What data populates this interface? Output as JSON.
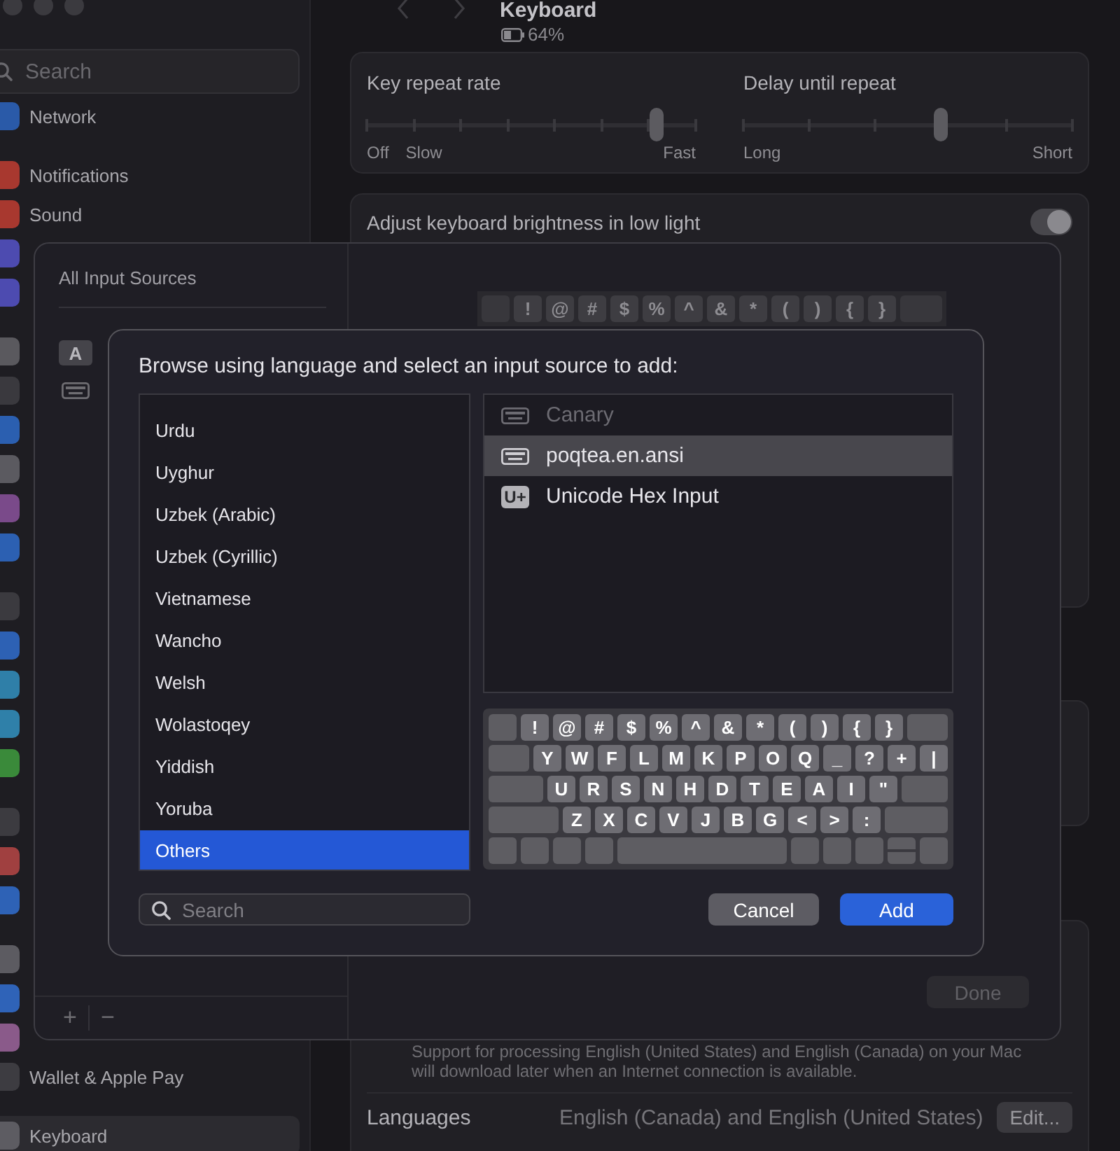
{
  "sidebar": {
    "search": {
      "placeholder": "Search"
    },
    "groups": [
      {
        "items": [
          {
            "label": "Network",
            "color": "#2a5aa8",
            "selected": false
          }
        ]
      },
      {
        "items": [
          {
            "label": "Notifications",
            "color": "#a8382f",
            "selected": false
          },
          {
            "label": "Sound",
            "color": "#a8382f",
            "selected": false
          },
          {
            "color": "#4d4bb0",
            "selected": false
          },
          {
            "color": "#4d4bb0",
            "selected": false
          }
        ]
      },
      {
        "items": [
          {
            "color": "#5a595e",
            "selected": false
          },
          {
            "color": "#3a393e",
            "selected": false
          },
          {
            "color": "#2b5fb0",
            "selected": false
          },
          {
            "color": "#5b5a60",
            "selected": false
          },
          {
            "color": "#7a4a8a",
            "selected": false
          },
          {
            "color": "#2c60b2",
            "selected": false
          }
        ]
      },
      {
        "items": [
          {
            "color": "#3b3a3f",
            "selected": false
          },
          {
            "color": "#2d61b4",
            "selected": false
          },
          {
            "color": "#2f7fa8",
            "selected": false
          },
          {
            "color": "#2f80a9",
            "selected": false
          },
          {
            "color": "#3a8a3a",
            "selected": false
          }
        ]
      },
      {
        "items": [
          {
            "color": "#3c3b40",
            "selected": false
          },
          {
            "color": "#a04040",
            "selected": false
          },
          {
            "color": "#2e62b6",
            "selected": false
          }
        ]
      },
      {
        "items": [
          {
            "color": "#5c5b61",
            "selected": false
          },
          {
            "color": "#2f63b8",
            "selected": false
          },
          {
            "color": "#8a5a8a",
            "selected": false
          },
          {
            "label": "Wallet & Apple Pay",
            "color": "#3d3c41",
            "selected": false
          }
        ]
      },
      {
        "items": [
          {
            "label": "Keyboard",
            "color": "#5d5c62",
            "selected": true
          }
        ]
      }
    ]
  },
  "settings": {
    "title": "Keyboard",
    "battery": "64%",
    "sliders": [
      {
        "kind": "rate",
        "label": "Key repeat rate",
        "level": 0.88,
        "scale": [
          "Off",
          "Slow",
          "Fast"
        ]
      },
      {
        "kind": "delay",
        "label": "Delay until repeat",
        "level": 0.6,
        "scale": [
          "Long",
          "Short"
        ]
      }
    ],
    "brightness": {
      "label": "Adjust keyboard brightness in low light",
      "on": true
    },
    "support_note": "Support for processing English (United States) and English (Canada) on your Mac will download later when an Internet connection is available.",
    "languages": {
      "label": "Languages",
      "value": "English (Canada) and English (United States)",
      "button": "Edit..."
    }
  },
  "input_sources_sheet": {
    "title": "All Input Sources",
    "sources": [
      {
        "kind": "letter",
        "icon_text": "A"
      },
      {
        "kind": "keyboard"
      }
    ],
    "preview_keys": [
      "!",
      "@",
      "#",
      "$",
      "%",
      "^",
      "&",
      "*",
      "(",
      ")",
      "{",
      "}"
    ],
    "add_button": "+",
    "remove_button": "−",
    "done_button": {
      "label": "Done",
      "disabled": true
    }
  },
  "add_sheet": {
    "title": "Browse using language and select an input source to add:",
    "languages": [
      {
        "label": "Urdu",
        "selected": false
      },
      {
        "label": "Uyghur",
        "selected": false
      },
      {
        "label": "Uzbek (Arabic)",
        "selected": false
      },
      {
        "label": "Uzbek (Cyrillic)",
        "selected": false
      },
      {
        "label": "Vietnamese",
        "selected": false
      },
      {
        "label": "Wancho",
        "selected": false
      },
      {
        "label": "Welsh",
        "selected": false
      },
      {
        "label": "Wolastoqey",
        "selected": false
      },
      {
        "label": "Yiddish",
        "selected": false
      },
      {
        "label": "Yoruba",
        "selected": false
      },
      {
        "label": "Others",
        "selected": true
      }
    ],
    "sources": [
      {
        "label": "Canary",
        "kind": "keyboard",
        "disabled": true,
        "selected": false
      },
      {
        "label": "poqtea.en.ansi",
        "kind": "keyboard",
        "disabled": false,
        "selected": true
      },
      {
        "label": "Unicode Hex Input",
        "kind": "unicode",
        "icon_text": "U+",
        "disabled": false,
        "selected": false
      }
    ],
    "keyboard_rows": [
      {
        "keys": [
          "!",
          "@",
          "#",
          "$",
          "%",
          "^",
          "&",
          "*",
          "(",
          ")",
          "{",
          "}"
        ]
      },
      {
        "keys": [
          "Y",
          "W",
          "F",
          "L",
          "M",
          "K",
          "P",
          "O",
          "Q",
          "_",
          "?",
          "+",
          "|"
        ]
      },
      {
        "keys": [
          "U",
          "R",
          "S",
          "N",
          "H",
          "D",
          "T",
          "E",
          "A",
          "I",
          "\""
        ]
      },
      {
        "keys": [
          "Z",
          "X",
          "C",
          "V",
          "J",
          "B",
          "G",
          "<",
          ">",
          ":"
        ]
      }
    ],
    "search": {
      "placeholder": "Search"
    },
    "buttons": [
      {
        "label": "Cancel",
        "kind": "secondary"
      },
      {
        "label": "Add",
        "kind": "primary"
      }
    ]
  }
}
